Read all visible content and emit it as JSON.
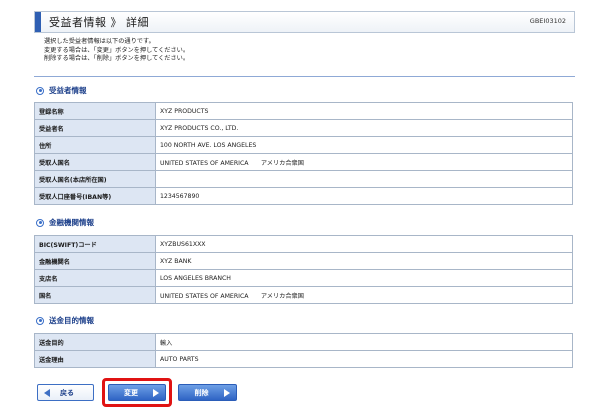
{
  "header": {
    "title": "受益者情報 》 詳細",
    "code": "GBEI03102"
  },
  "intro": [
    "選択した受益者情報は以下の通りです。",
    "変更する場合は、「変更」ボタンを押してください。",
    "削除する場合は、「削除」ボタンを押してください。"
  ],
  "sections": {
    "beneficiary": {
      "title": "受益者情報",
      "rows": [
        {
          "label": "登録名称",
          "value": "XYZ PRODUCTS"
        },
        {
          "label": "受益者名",
          "value": "XYZ PRODUCTS CO., LTD."
        },
        {
          "label": "住所",
          "value": "100 NORTH AVE. LOS ANGELES"
        },
        {
          "label": "受取人国名",
          "value": "UNITED STATES OF AMERICA　　アメリカ合衆国"
        },
        {
          "label": "受取人国名(本店所在国)",
          "value": ""
        },
        {
          "label": "受取人口座番号(IBAN等)",
          "value": "1234567890"
        }
      ]
    },
    "bank": {
      "title": "金融機関情報",
      "rows": [
        {
          "label": "BIC(SWIFT)コード",
          "value": "XYZBUS61XXX"
        },
        {
          "label": "金融機関名",
          "value": "XYZ BANK"
        },
        {
          "label": "支店名",
          "value": "LOS ANGELES BRANCH"
        },
        {
          "label": "国名",
          "value": "UNITED STATES OF AMERICA　　アメリカ合衆国"
        }
      ]
    },
    "purpose": {
      "title": "送金目的情報",
      "rows": [
        {
          "label": "送金目的",
          "value": "輸入"
        },
        {
          "label": "送金理由",
          "value": "AUTO PARTS"
        }
      ]
    }
  },
  "buttons": {
    "back": "戻る",
    "change": "変更",
    "delete": "削除"
  },
  "colors": {
    "accent": "#2f64c4",
    "highlight": "#e01313",
    "label_bg": "#dde6f3"
  }
}
